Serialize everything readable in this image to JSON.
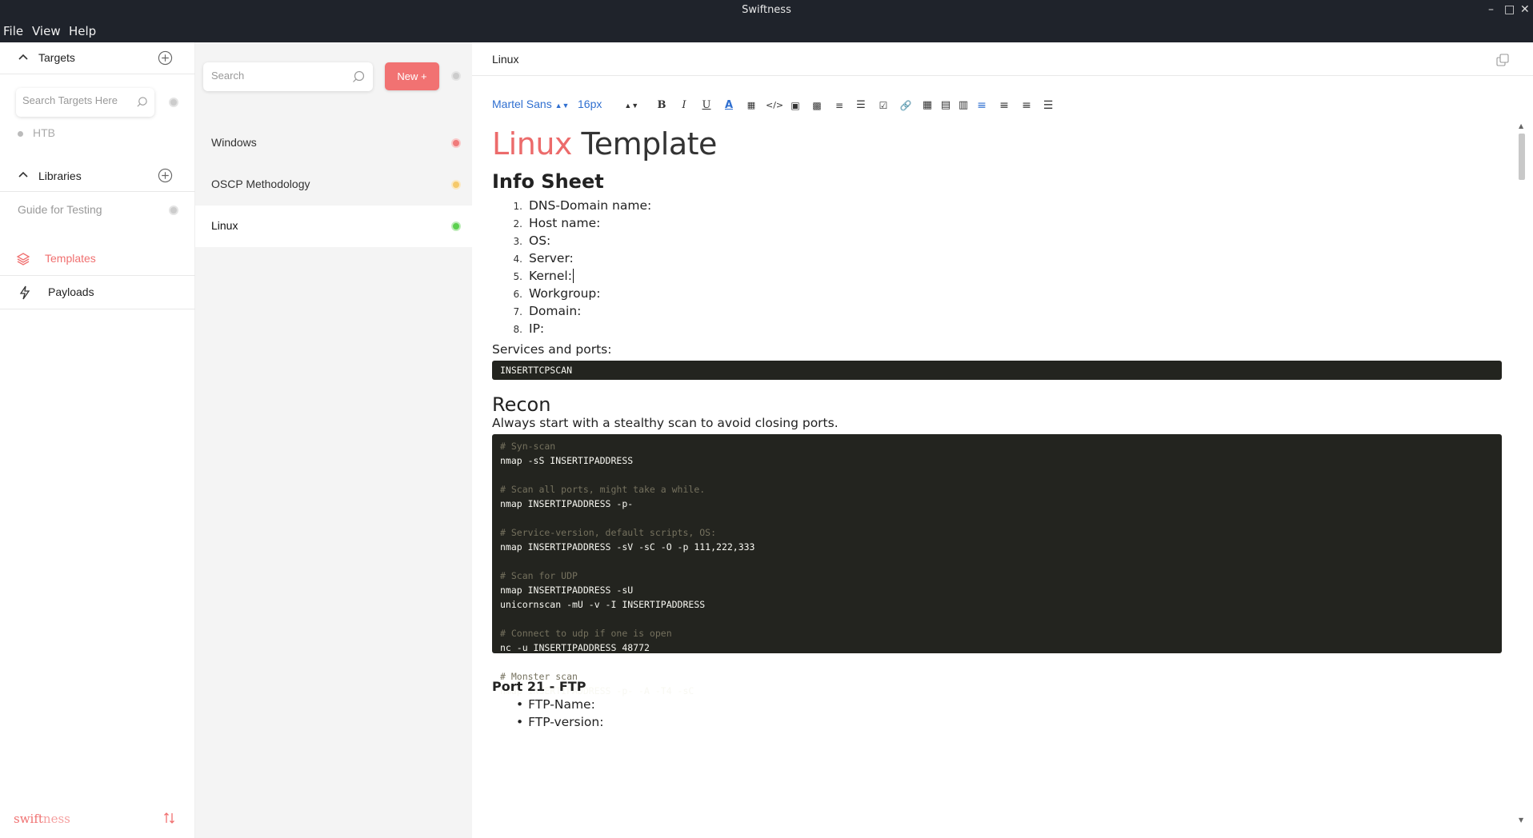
{
  "window": {
    "title": "Swiftness"
  },
  "menu": [
    "File",
    "View",
    "Help"
  ],
  "sidebar": {
    "targets_label": "Targets",
    "search_placeholder": "Search Targets Here",
    "targets": [
      "HTB"
    ],
    "libraries_label": "Libraries",
    "libraries": [
      "Guide for Testing"
    ],
    "nav": [
      {
        "label": "Templates",
        "icon": "layers-icon",
        "active": true
      },
      {
        "label": "Payloads",
        "icon": "bolt-icon",
        "active": false
      }
    ],
    "brand_left": "swift",
    "brand_right": "ness"
  },
  "list": {
    "search_placeholder": "Search",
    "new_label": "New +",
    "items": [
      {
        "name": "Windows",
        "status_color": "#f07a7a"
      },
      {
        "name": "OSCP Methodology",
        "status_color": "#f5c96a"
      },
      {
        "name": "Linux",
        "status_color": "#5bd04e"
      }
    ]
  },
  "editor": {
    "name": "Linux",
    "font": "Martel Sans",
    "size": "16px",
    "title_red": "Linux",
    "title_dark": "Template",
    "info_heading": "Info Sheet",
    "info_items": [
      "DNS-Domain name:",
      "Host name:",
      "OS:",
      "Server:",
      "Kernel:",
      "Workgroup:",
      "Domain:",
      "IP:"
    ],
    "services_label": "Services and ports:",
    "services_code": "INSERTTCPSCAN",
    "recon_heading": "Recon",
    "recon_text": "Always start with a stealthy scan to avoid closing ports.",
    "recon_code": [
      "# Syn-scan",
      "nmap -sS INSERTIPADDRESS",
      "",
      "# Scan all ports, might take a while.",
      "nmap INSERTIPADDRESS -p-",
      "",
      "# Service-version, default scripts, OS:",
      "nmap INSERTIPADDRESS -sV -sC -O -p 111,222,333",
      "",
      "# Scan for UDP",
      "nmap INSERTIPADDRESS -sU",
      "unicornscan -mU -v -I INSERTIPADDRESS",
      "",
      "# Connect to udp if one is open",
      "nc -u INSERTIPADDRESS 48772",
      "",
      "# Monster scan",
      "nmap INSERTIPADDRESS -p- -A -T4 -sC"
    ],
    "ftp_heading": "Port 21 - FTP",
    "ftp_items": [
      "FTP-Name:",
      "FTP-version:"
    ]
  },
  "colors": {
    "accent": "#f17272",
    "titlebar": "#1f232b",
    "code_bg": "#23241f",
    "link_blue": "#2f6fd0"
  }
}
